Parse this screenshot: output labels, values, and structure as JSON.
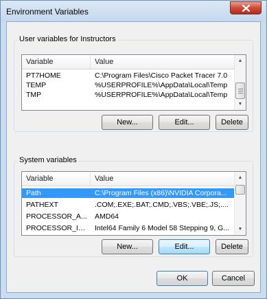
{
  "window": {
    "title": "Environment Variables"
  },
  "user_vars": {
    "group_label": "User variables for Instructors",
    "columns": [
      "Variable",
      "Value"
    ],
    "rows": [
      {
        "variable": "PT7HOME",
        "value": "C:\\Program Files\\Cisco Packet Tracer 7.0"
      },
      {
        "variable": "TEMP",
        "value": "%USERPROFILE%\\AppData\\Local\\Temp"
      },
      {
        "variable": "TMP",
        "value": "%USERPROFILE%\\AppData\\Local\\Temp"
      }
    ],
    "buttons": {
      "new": "New...",
      "edit": "Edit...",
      "delete": "Delete"
    }
  },
  "system_vars": {
    "group_label": "System variables",
    "columns": [
      "Variable",
      "Value"
    ],
    "rows": [
      {
        "variable": "Path",
        "value": "C:\\Program Files (x86)\\NVIDIA Corpora...",
        "selected": true
      },
      {
        "variable": "PATHEXT",
        "value": ".COM;.EXE;.BAT;.CMD;.VBS;.VBE;.JS;...."
      },
      {
        "variable": "PROCESSOR_A...",
        "value": "AMD64"
      },
      {
        "variable": "PROCESSOR_ID...",
        "value": "Intel64 Family 6 Model 58 Stepping 9, G..."
      }
    ],
    "buttons": {
      "new": "New...",
      "edit": "Edit...",
      "delete": "Delete"
    }
  },
  "dialog_buttons": {
    "ok": "OK",
    "cancel": "Cancel"
  },
  "icons": {
    "close": "close-icon",
    "scroll_up": "scroll-up-arrow-icon",
    "scroll_down": "scroll-down-arrow-icon"
  },
  "colors": {
    "selection": "#3399ff",
    "title_bar": "#c9dcf0",
    "close_button": "#cf4a37"
  }
}
